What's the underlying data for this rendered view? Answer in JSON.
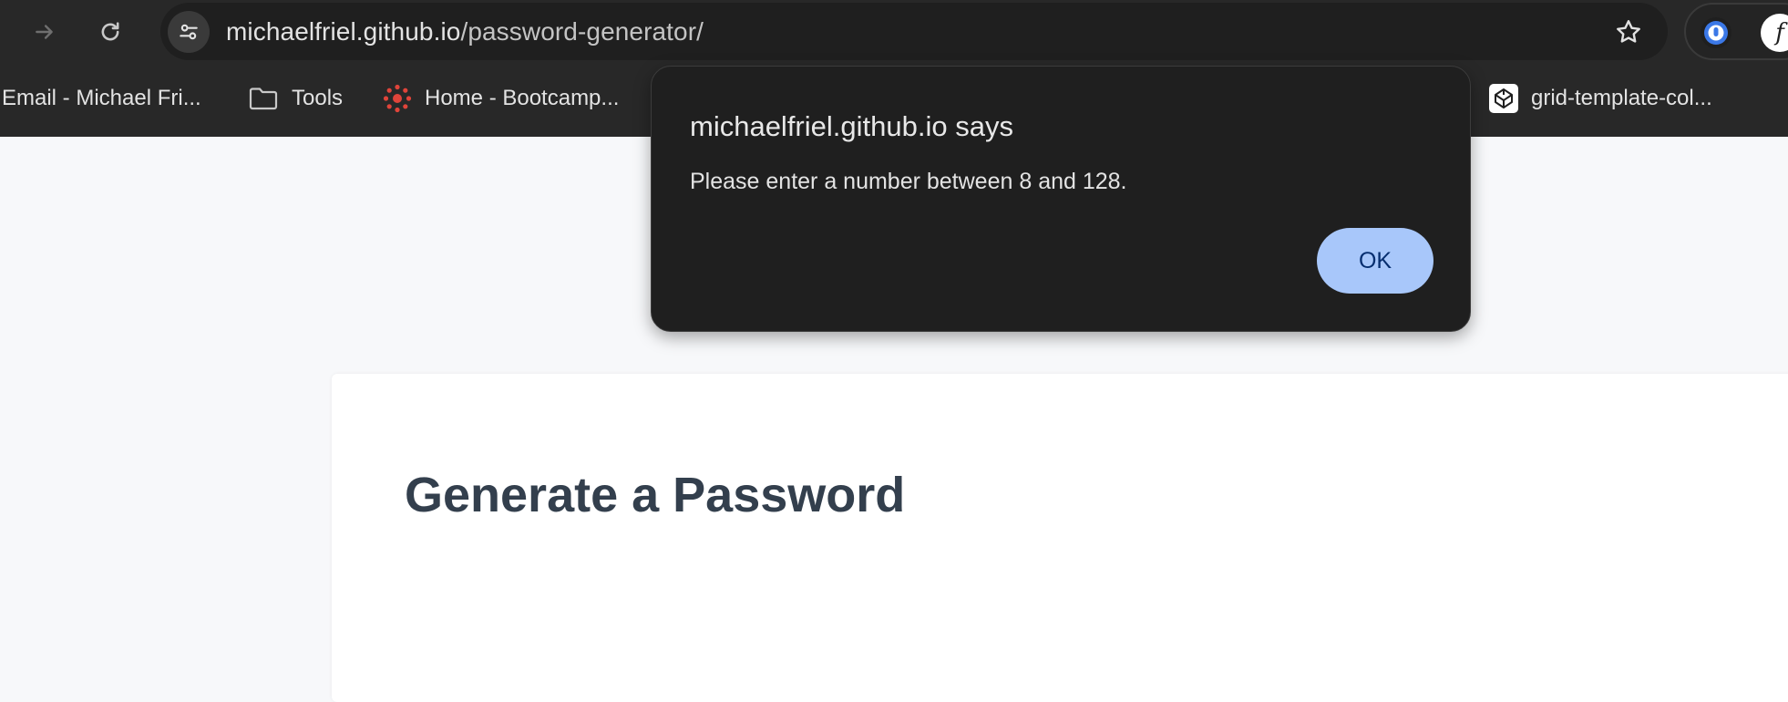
{
  "browser": {
    "url_host": "michaelfriel.github.io",
    "url_path": "/password-generator/",
    "extension_2_glyph": "f",
    "icons": {
      "forward": "arrow-right-icon",
      "reload": "reload-icon",
      "site_info": "tune-icon",
      "star": "star-icon",
      "folder": "folder-icon"
    }
  },
  "bookmarks": [
    {
      "label": "Email - Michael Fri..."
    },
    {
      "label": "Tools"
    },
    {
      "label": "Home - Bootcamp..."
    },
    {
      "label": "grid-template-col..."
    }
  ],
  "page": {
    "title": "Generate a Password"
  },
  "dialog": {
    "title": "michaelfriel.github.io says",
    "message": "Please enter a number between 8 and 128.",
    "ok_label": "OK"
  },
  "colors": {
    "toolbar": "#282828",
    "omnibox": "#1f1f1f",
    "dialog_bg": "#1f1f1f",
    "ok_button": "#a8c7fa",
    "ok_text": "#062e6f",
    "page_bg": "#f7f8fa",
    "title_text": "#333f4d",
    "canvas_icon": "#e0443a"
  }
}
